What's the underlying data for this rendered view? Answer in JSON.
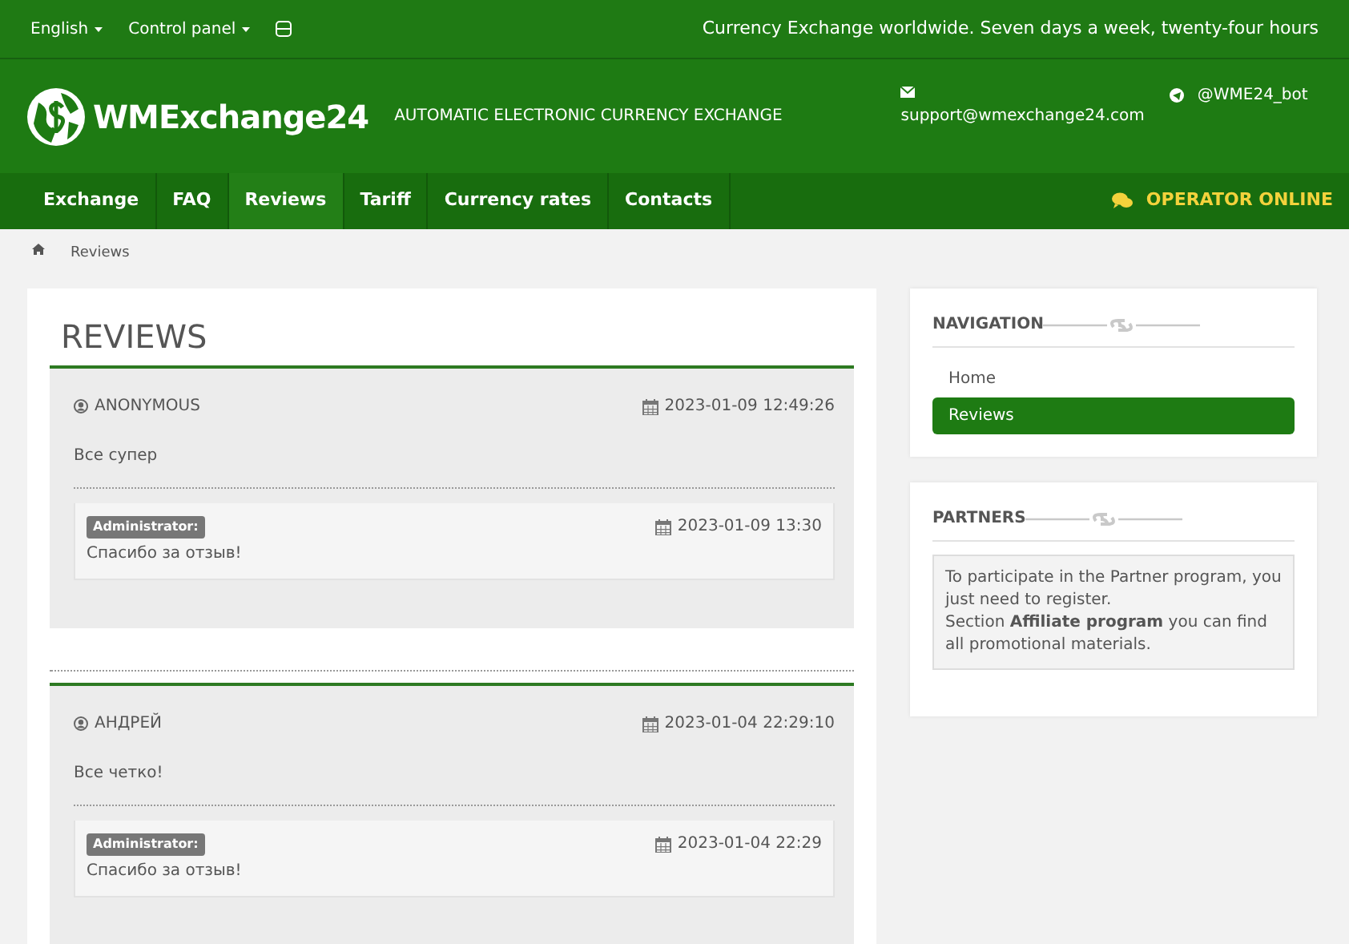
{
  "topbar": {
    "language": "English",
    "control_panel": "Control panel",
    "tagline": "Currency Exchange worldwide. Seven days a week, twenty-four hours"
  },
  "header": {
    "logo": "WMExchange24",
    "slogan": "AUTOMATIC ELECTRONIC CURRENCY EXCHANGE",
    "email": "support@wmexchange24.com",
    "telegram": "@WME24_bot"
  },
  "nav": {
    "items": [
      {
        "label": "Exchange",
        "selected": false
      },
      {
        "label": "FAQ",
        "selected": false
      },
      {
        "label": "Reviews",
        "selected": true
      },
      {
        "label": "Tariff",
        "selected": false
      },
      {
        "label": "Currency rates",
        "selected": false
      },
      {
        "label": "Contacts",
        "selected": false
      }
    ],
    "operator": "OPERATOR ONLINE"
  },
  "breadcrumb": [
    "Reviews"
  ],
  "reviews": {
    "title": "REVIEWS",
    "items": [
      {
        "author": "ANONYMOUS",
        "date": "2023-01-09 12:49:26",
        "text": "Все супер",
        "reply": {
          "badge": "Administrator:",
          "date": "2023-01-09 13:30",
          "text": "Спасибо за отзыв!"
        }
      },
      {
        "author": "АНДРЕЙ",
        "date": "2023-01-04 22:29:10",
        "text": "Все четко!",
        "reply": {
          "badge": "Administrator:",
          "date": "2023-01-04 22:29",
          "text": "Спасибо за отзыв!"
        }
      }
    ]
  },
  "sidebar": {
    "navigation": {
      "title": "NAVIGATION",
      "items": [
        {
          "label": "Home",
          "selected": false
        },
        {
          "label": "Reviews",
          "selected": true
        }
      ]
    },
    "partners": {
      "title": "PARTNERS",
      "lines": [
        "To participate in the Partner program, you just need to register.",
        "Section **Affiliate program** you can find all promotional materials."
      ]
    }
  }
}
